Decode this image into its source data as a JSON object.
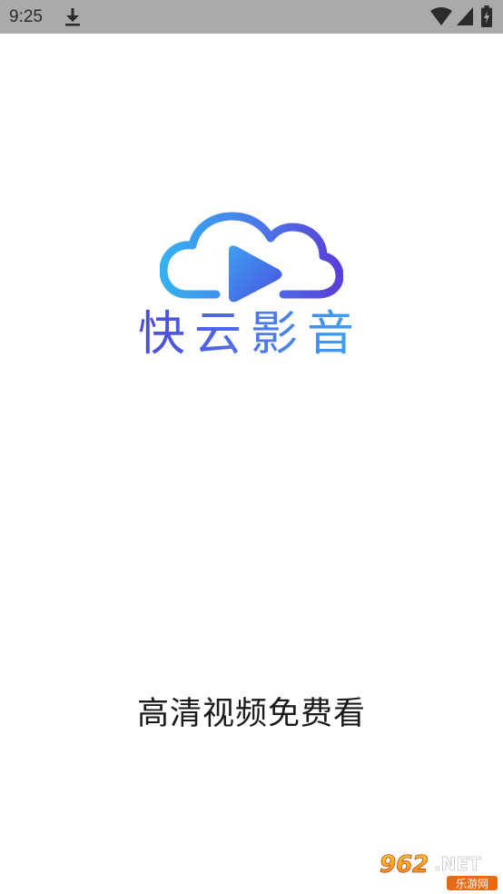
{
  "status_bar": {
    "time": "9:25",
    "icons": [
      "download-icon",
      "wifi-icon",
      "signal-icon",
      "battery-icon"
    ],
    "background": "#aaaaaa"
  },
  "splash": {
    "app_name": "快云影音",
    "slogan": "高清视频免费看",
    "logo_colors": {
      "gradient_start": "#4a3fd8",
      "gradient_mid": "#4f6ee8",
      "gradient_end": "#36b0f0"
    }
  },
  "watermark": {
    "brand_number": "962",
    "brand_suffix": ".NET",
    "brand_tagline": "乐游网"
  }
}
